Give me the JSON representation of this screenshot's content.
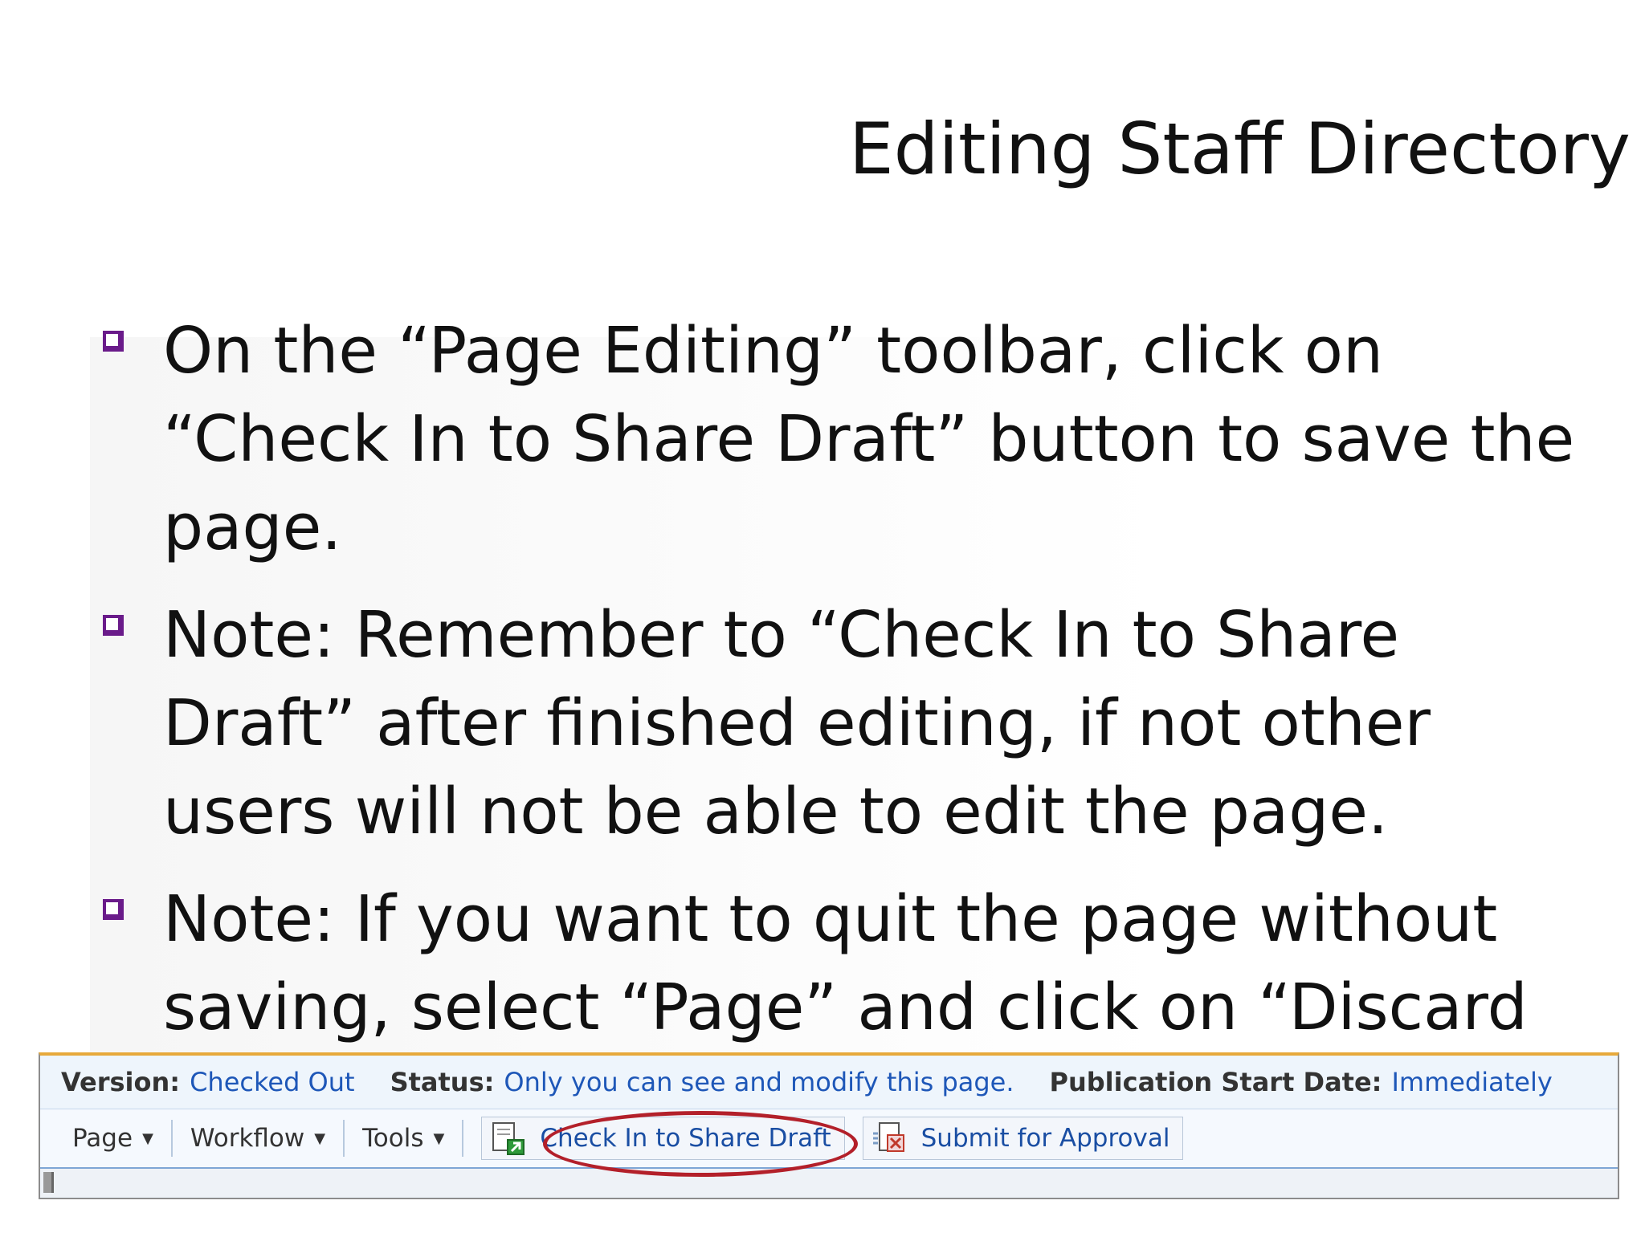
{
  "slide": {
    "title": "Editing Staff Directory",
    "bullets": [
      "On the “Page Editing” toolbar, click on “Check In to Share Draft” button to save the page.",
      "Note: Remember to “Check In to Share Draft” after finished editing, if not other users will not be able to edit the page.",
      "Note: If you want to quit the page without saving, select “Page” and click on “Discard Check Out”."
    ]
  },
  "toolbar": {
    "version_label": "Version:",
    "version_value": "Checked Out",
    "status_label": "Status:",
    "status_value": "Only you can see and modify this page.",
    "pubdate_label": "Publication Start Date:",
    "pubdate_value": "Immediately",
    "menus": [
      "Page",
      "Workflow",
      "Tools"
    ],
    "check_in_button": "Check In to Share Draft",
    "submit_button": "Submit for Approval",
    "icons": [
      "check-in-icon",
      "submit-approval-icon",
      "dropdown-caret-icon"
    ]
  },
  "colors": {
    "accent_red": "#b3202a",
    "link_blue": "#1e57b8",
    "bullet_purple": "#6a1b8a"
  }
}
